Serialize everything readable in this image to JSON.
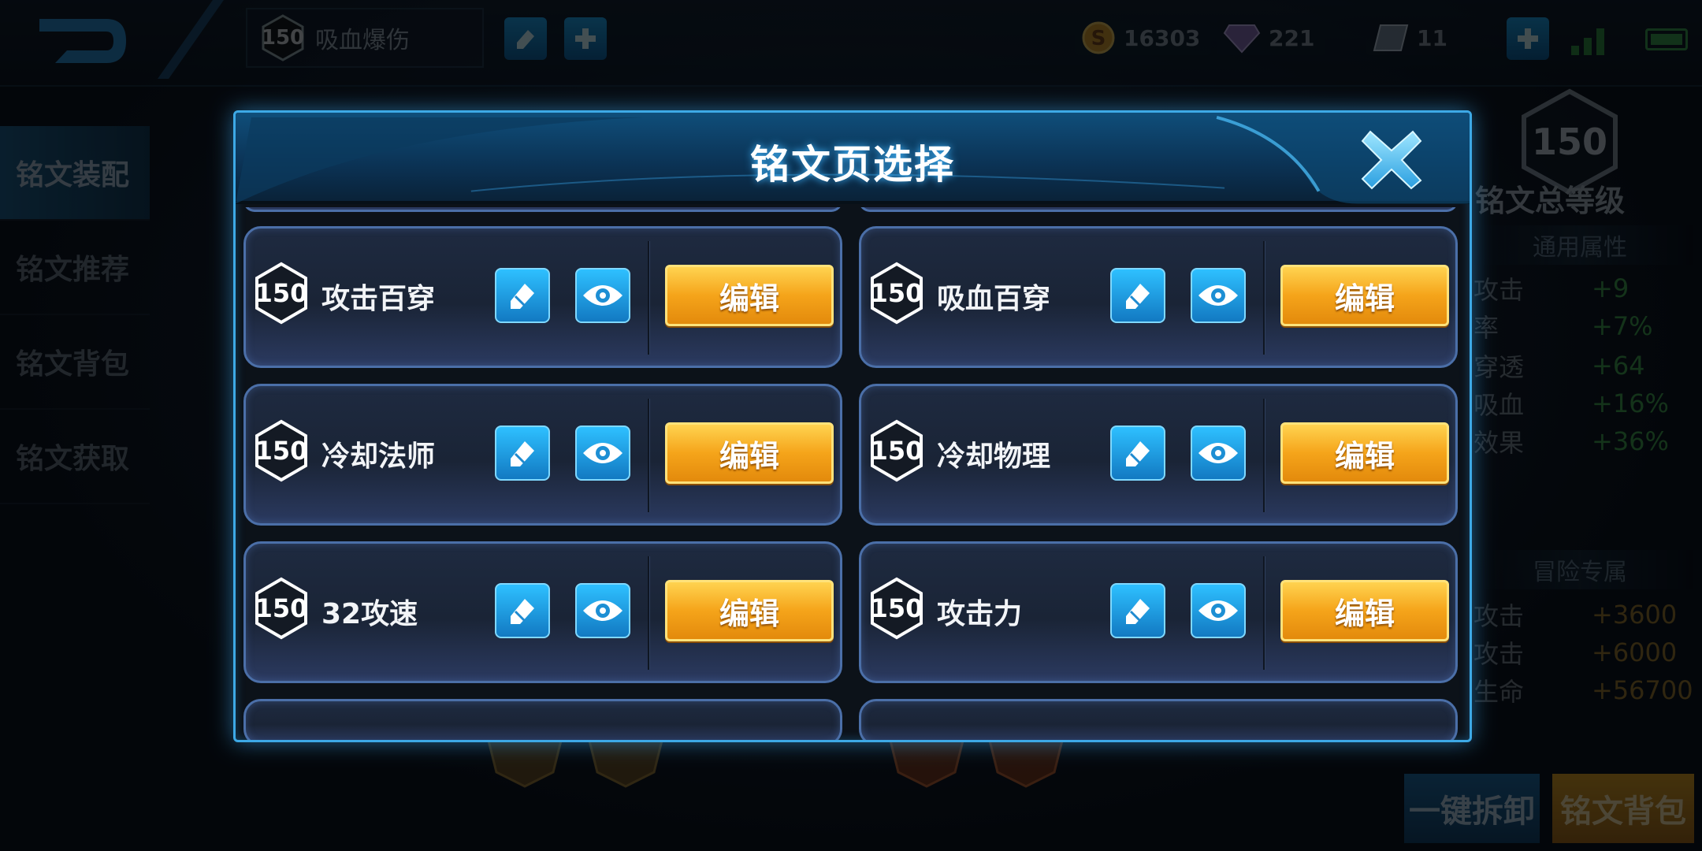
{
  "topbar": {
    "current_page_level": "150",
    "current_page_name": "吸血爆伤",
    "currencies": [
      {
        "icon": "gold-coin-icon",
        "value": "16303"
      },
      {
        "icon": "diamond-icon",
        "value": "221"
      },
      {
        "icon": "voucher-icon",
        "value": "11"
      }
    ]
  },
  "side_nav": {
    "items": [
      {
        "label": "铭文装配",
        "active": true
      },
      {
        "label": "铭文推荐",
        "active": false
      },
      {
        "label": "铭文背包",
        "active": false
      },
      {
        "label": "铭文获取",
        "active": false
      }
    ]
  },
  "right_panel": {
    "total_level": "150",
    "total_level_label": "铭文总等级",
    "general_header": "通用属性",
    "general_stats": [
      {
        "key": "攻击",
        "value": "+9"
      },
      {
        "key": "率",
        "value": "+7%"
      },
      {
        "key": "穿透",
        "value": "+64"
      },
      {
        "key": "吸血",
        "value": "+16%"
      },
      {
        "key": "效果",
        "value": "+36%"
      }
    ],
    "adventure_header": "冒险专属",
    "adventure_stats": [
      {
        "key": "攻击",
        "value": "+3600"
      },
      {
        "key": "攻击",
        "value": "+6000"
      },
      {
        "key": "生命",
        "value": "+56700"
      }
    ]
  },
  "bottom_buttons": {
    "unload": "一键拆卸",
    "bag": "铭文背包"
  },
  "modal": {
    "title": "铭文页选择",
    "edit_label": "编辑",
    "pages": [
      {
        "level": "150",
        "name": "攻击百穿"
      },
      {
        "level": "150",
        "name": "吸血百穿"
      },
      {
        "level": "150",
        "name": "冷却法师"
      },
      {
        "level": "150",
        "name": "冷却物理"
      },
      {
        "level": "150",
        "name": "32攻速"
      },
      {
        "level": "150",
        "name": "攻击力"
      }
    ]
  },
  "colors": {
    "accent_blue": "#3da9e6",
    "edit_orange": "#f5a41a",
    "stat_green": "#3fa447",
    "stat_gold": "#a07a26"
  }
}
